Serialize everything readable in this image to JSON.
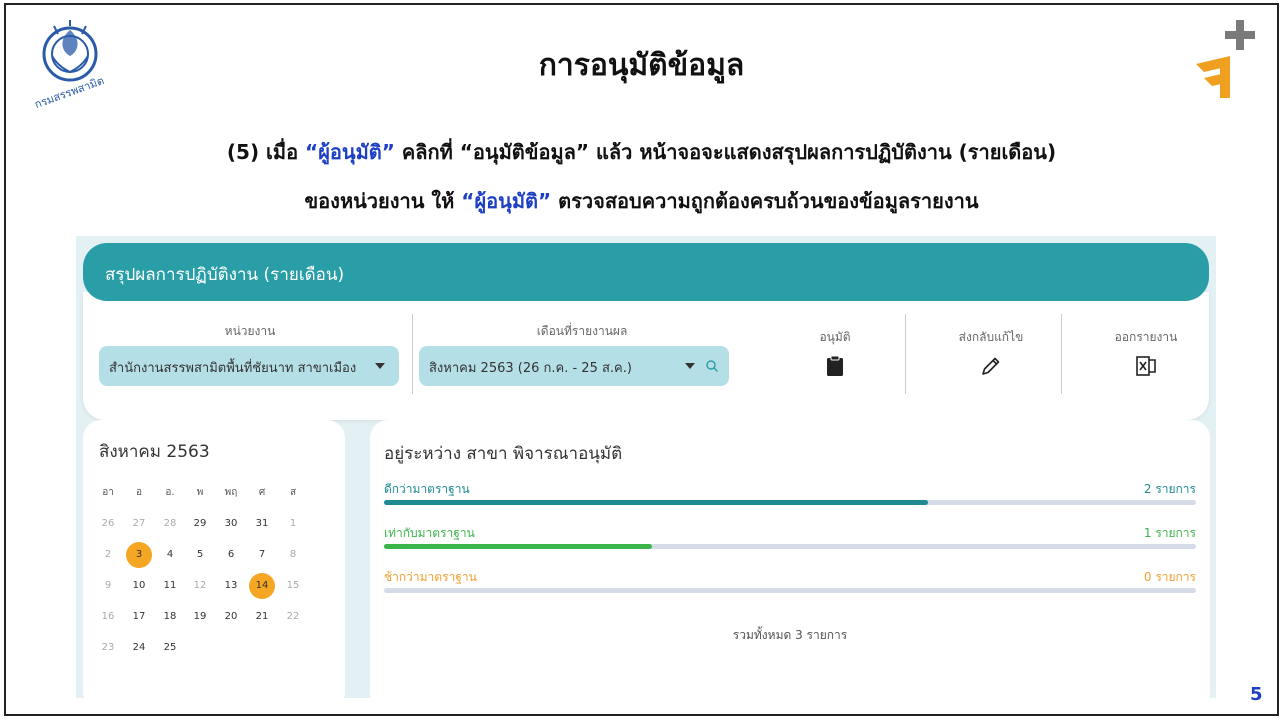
{
  "slide": {
    "title": "การอนุมัติข้อมูล",
    "logo_text": "กรมสรรพสามิต",
    "instruction_line1": [
      {
        "text": "(5) เมื่อ ",
        "hl": false
      },
      {
        "text": "“ผู้อนุมัติ”",
        "hl": true
      },
      {
        "text": " คลิกที่ “อนุมัติข้อมูล” แล้ว หน้าจอจะแสดงสรุปผลการปฏิบัติงาน (รายเดือน)",
        "hl": false
      }
    ],
    "instruction_line2": [
      {
        "text": "ของหน่วยงาน ให้ ",
        "hl": false
      },
      {
        "text": "“ผู้อนุมัติ”",
        "hl": true
      },
      {
        "text": " ตรวจสอบความถูกต้องครบถ้วนของข้อมูลรายงาน",
        "hl": false
      }
    ],
    "page_number": "5",
    "highlight_color": "#1d3fc4"
  },
  "app": {
    "header_title": "สรุปผลการปฏิบัติงาน (รายเดือน)",
    "unit_label": "หน่วยงาน",
    "unit_value": "สำนักงานสรรพสามิตพื้นที่ชัยนาท สาขาเมือง",
    "month_label": "เดือนที่รายงานผล",
    "month_value": "สิงหาคม 2563 (26 ก.ค. - 25 ส.ค.)",
    "approve_label": "อนุมัติ",
    "return_label": "ส่งกลับแก้ไข",
    "export_label": "ออกรายงาน",
    "icons": {
      "approve": "clipboard-icon",
      "return": "pencil-icon",
      "export": "excel-icon",
      "search": "search-icon"
    }
  },
  "calendar": {
    "title": "สิงหาคม 2563",
    "weekdays": [
      "อา",
      "อ",
      "อ.",
      "พ",
      "พฤ",
      "ศ",
      "ส"
    ],
    "weeks": [
      [
        {
          "d": "26",
          "dim": true
        },
        {
          "d": "27",
          "dim": true
        },
        {
          "d": "28",
          "dim": true
        },
        {
          "d": "29"
        },
        {
          "d": "30"
        },
        {
          "d": "31"
        },
        {
          "d": "1",
          "dim": true
        }
      ],
      [
        {
          "d": "2",
          "dim": true
        },
        {
          "d": "3",
          "hi": true
        },
        {
          "d": "4"
        },
        {
          "d": "5"
        },
        {
          "d": "6"
        },
        {
          "d": "7"
        },
        {
          "d": "8",
          "dim": true
        }
      ],
      [
        {
          "d": "9",
          "dim": true
        },
        {
          "d": "10"
        },
        {
          "d": "11"
        },
        {
          "d": "12",
          "dim": true
        },
        {
          "d": "13"
        },
        {
          "d": "14",
          "hi": true
        },
        {
          "d": "15",
          "dim": true
        }
      ],
      [
        {
          "d": "16",
          "dim": true
        },
        {
          "d": "17"
        },
        {
          "d": "18"
        },
        {
          "d": "19"
        },
        {
          "d": "20"
        },
        {
          "d": "21"
        },
        {
          "d": "22",
          "dim": true
        }
      ],
      [
        {
          "d": "23",
          "dim": true
        },
        {
          "d": "24"
        },
        {
          "d": "25"
        }
      ]
    ],
    "highlight_color": "#f5a623"
  },
  "status": {
    "title": "อยู่ระหว่าง สาขา พิจารณาอนุมัติ",
    "rows": [
      {
        "label": "ดีกว่ามาตราฐาน",
        "count": "2 รายการ",
        "fraction": 0.67,
        "color": "#1f8a92"
      },
      {
        "label": "เท่ากับมาตราฐาน",
        "count": "1 รายการ",
        "fraction": 0.33,
        "color": "#3bb54a"
      },
      {
        "label": "ช้ากว่ามาตราฐาน",
        "count": "0 รายการ",
        "fraction": 0,
        "color": "#f0a030"
      }
    ],
    "total": "รวมทั้งหมด 3 รายการ"
  }
}
